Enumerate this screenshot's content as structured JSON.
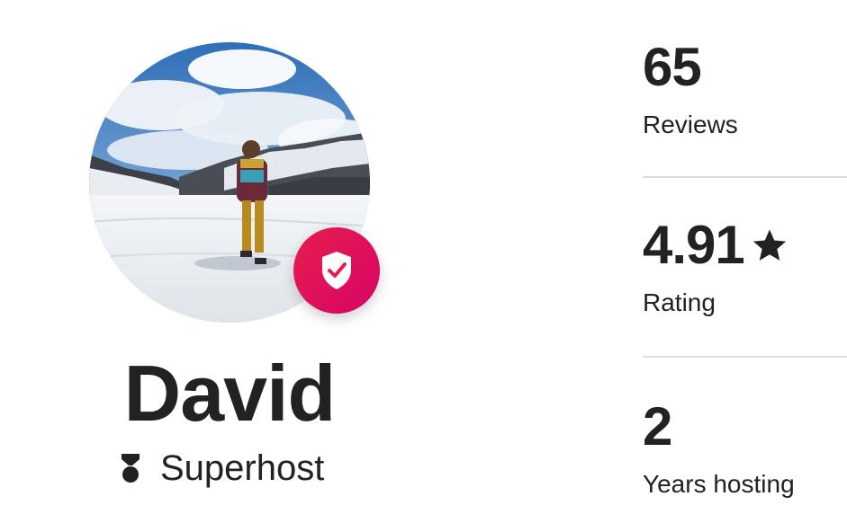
{
  "host": {
    "name": "David",
    "badge_label": "Superhost"
  },
  "stats": [
    {
      "value": "65",
      "label": "Reviews"
    },
    {
      "value": "4.91",
      "label": "Rating",
      "icon": "star-icon"
    },
    {
      "value": "2",
      "label": "Years hosting"
    }
  ],
  "colors": {
    "text": "#222222",
    "verified_badge": "#e61e4d",
    "divider": "#dddddd"
  },
  "icons": {
    "verified": "shield-check-icon",
    "superhost": "superhost-badge-icon",
    "rating": "star-icon"
  }
}
